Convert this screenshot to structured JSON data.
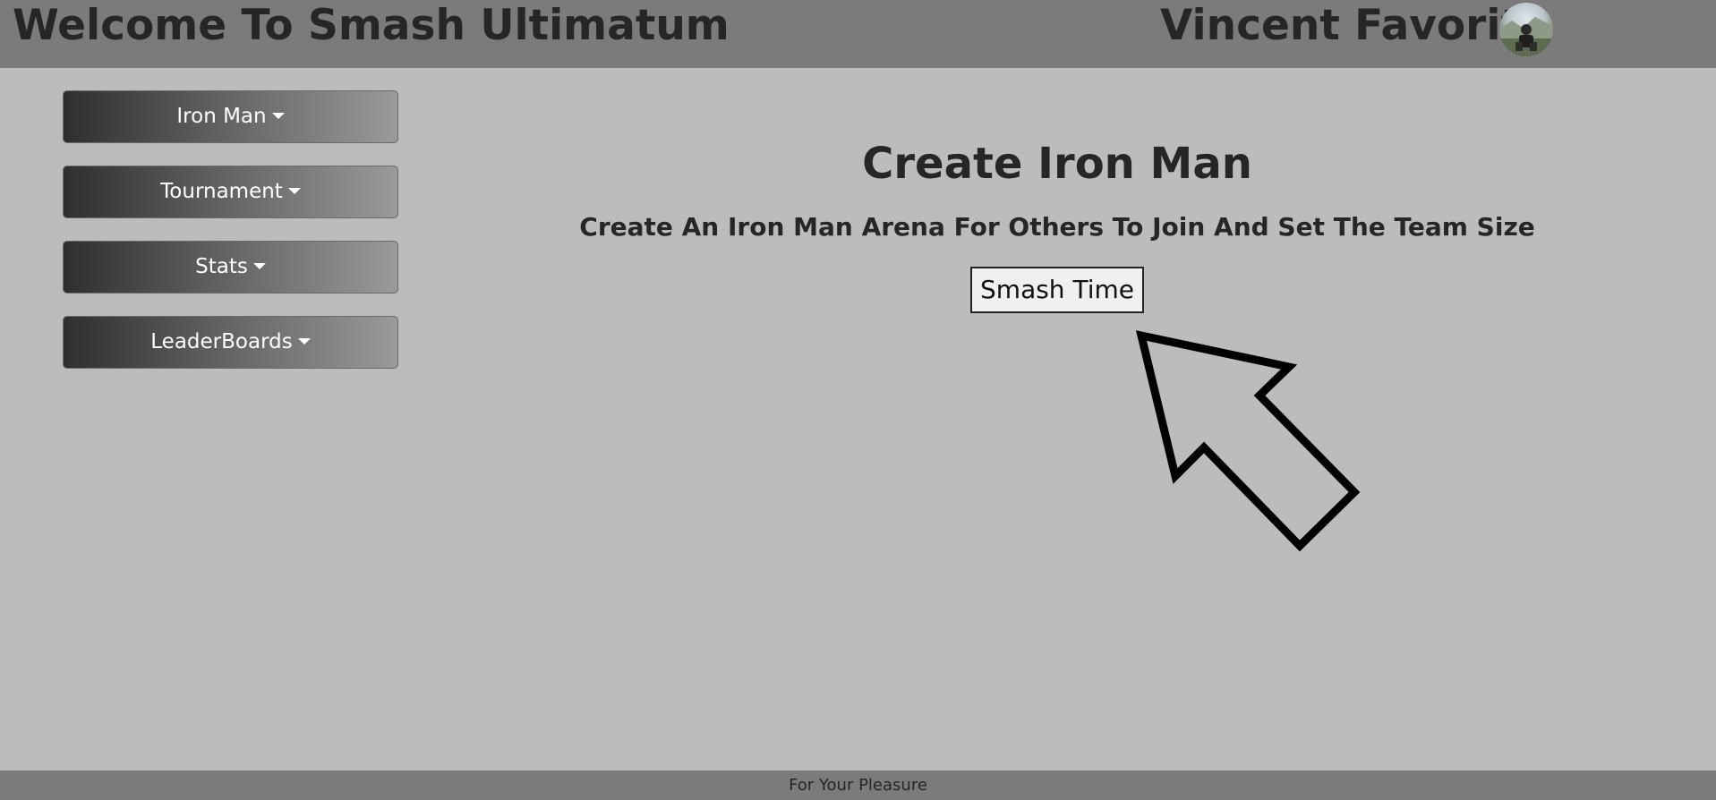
{
  "header": {
    "site_title": "Welcome To Smash Ultimatum",
    "user_name": "Vincent Favorito",
    "avatar_icon": "user-avatar"
  },
  "sidebar": {
    "items": [
      {
        "label": "Iron Man"
      },
      {
        "label": "Tournament"
      },
      {
        "label": "Stats"
      },
      {
        "label": "LeaderBoards"
      }
    ]
  },
  "main": {
    "heading": "Create Iron Man",
    "description": "Create An Iron Man Arena For Others To Join And Set The Team Size",
    "button_label": "Smash Time",
    "pointer_icon": "arrow-pointer-icon"
  },
  "footer": {
    "text": "For Your Pleasure"
  },
  "colors": {
    "header_bg": "#7b7b7b",
    "page_bg": "#bcbcbc",
    "text_dark": "#262626"
  }
}
